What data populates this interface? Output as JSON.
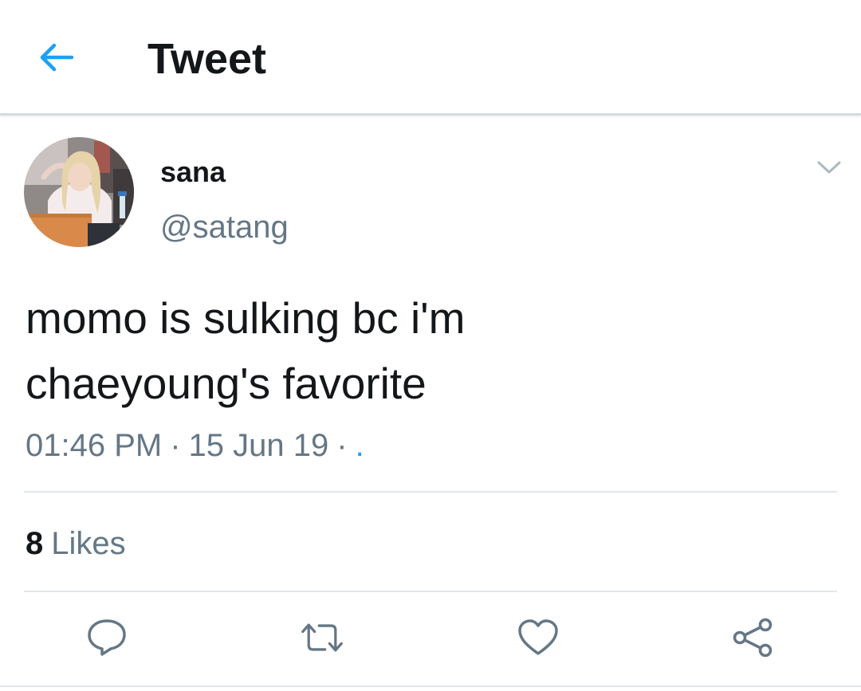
{
  "header": {
    "title": "Tweet",
    "back_icon": "arrow-left-icon",
    "accent_color": "#1da1f2"
  },
  "tweet": {
    "author": {
      "display_name": "sana",
      "handle": "@satang",
      "avatar_icon": "profile-photo"
    },
    "text_line1": "momo is sulking bc i'm",
    "text_line2": "chaeyoung's favorite",
    "time": "01:46 PM",
    "separator": "·",
    "date": "15 Jun 19",
    "source": ".",
    "likes_count": "8",
    "likes_label": "Likes",
    "menu_icon": "chevron-down-icon"
  },
  "actions": [
    {
      "name": "reply",
      "icon": "reply-icon"
    },
    {
      "name": "retweet",
      "icon": "retweet-icon"
    },
    {
      "name": "like",
      "icon": "heart-icon"
    },
    {
      "name": "share",
      "icon": "share-icon"
    }
  ],
  "colors": {
    "text_primary": "#14171a",
    "text_secondary": "#657786",
    "icon_gray": "#657786",
    "divider": "#e1e8ed"
  }
}
